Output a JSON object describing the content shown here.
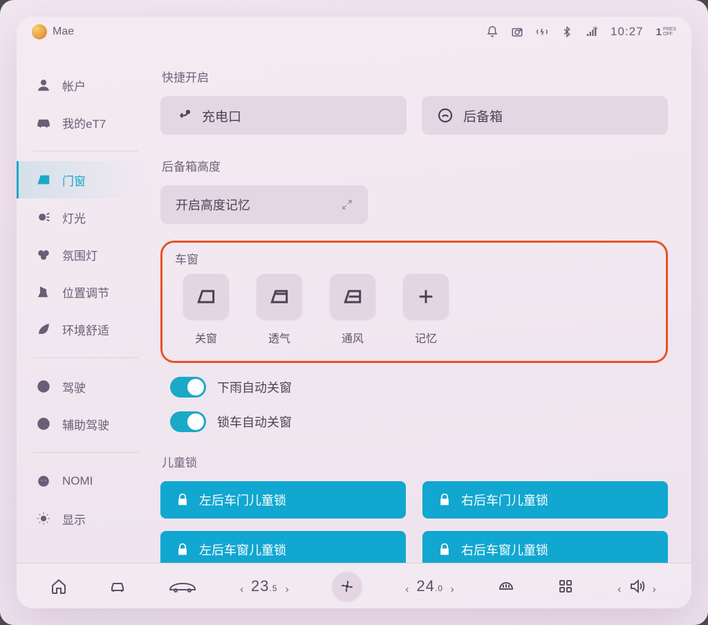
{
  "status": {
    "user_name": "Mae",
    "time": "10:27",
    "gear_num": "1",
    "gear_text": "PRES\nOFF"
  },
  "sidebar": {
    "items": [
      {
        "label": "帐户"
      },
      {
        "label": "我的eT7"
      },
      {
        "label": "门窗"
      },
      {
        "label": "灯光"
      },
      {
        "label": "氛围灯"
      },
      {
        "label": "位置调节"
      },
      {
        "label": "环境舒适"
      },
      {
        "label": "驾驶"
      },
      {
        "label": "辅助驾驶"
      },
      {
        "label": "NOMI"
      },
      {
        "label": "显示"
      }
    ]
  },
  "quick": {
    "title": "快捷开启",
    "charge": "充电口",
    "trunk": "后备箱"
  },
  "trunk_height": {
    "title": "后备箱高度",
    "memory": "开启高度记忆"
  },
  "windows": {
    "title": "车窗",
    "items": [
      {
        "label": "关窗"
      },
      {
        "label": "透气"
      },
      {
        "label": "通风"
      },
      {
        "label": "记忆"
      }
    ],
    "rain_auto": "下雨自动关窗",
    "lock_auto": "锁车自动关窗"
  },
  "childlock": {
    "title": "儿童锁",
    "btns": [
      "左后车门儿童锁",
      "右后车门儿童锁",
      "左后车窗儿童锁",
      "右后车窗儿童锁"
    ]
  },
  "dock": {
    "temp_left": "23",
    "temp_left_dec": ".5",
    "temp_right": "24",
    "temp_right_dec": ".0"
  }
}
